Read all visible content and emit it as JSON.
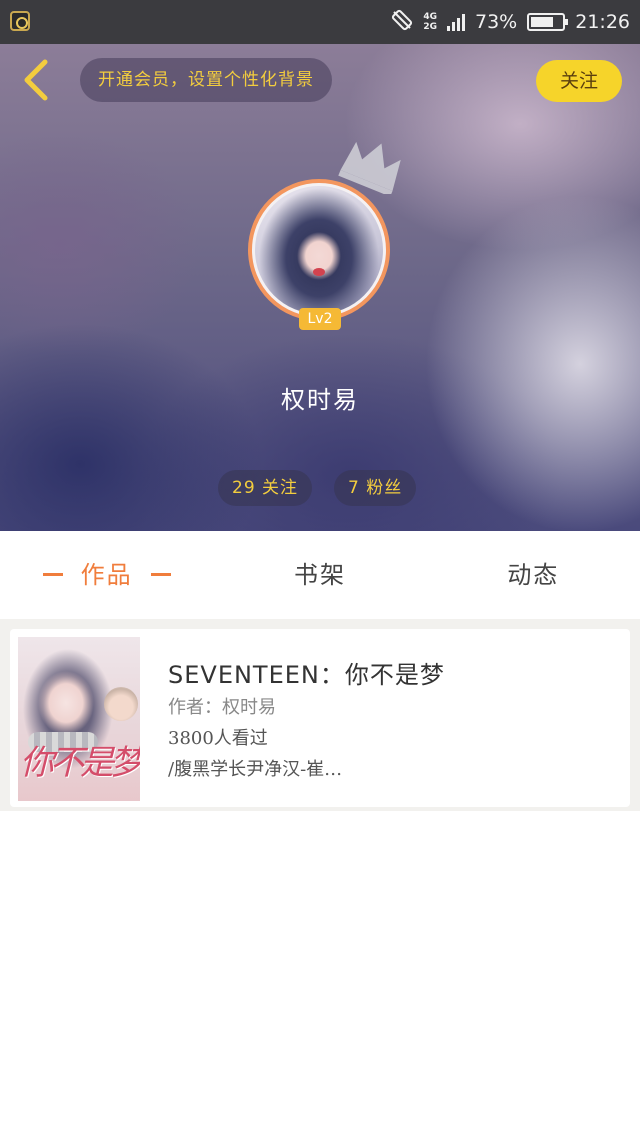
{
  "status_bar": {
    "network_top": "4G",
    "network_bottom": "2G",
    "battery_percent": "73%",
    "battery_level": 0.73,
    "time": "21:26"
  },
  "header": {
    "vip_banner": "开通会员，设置个性化背景",
    "follow_button": "关注",
    "level": "Lv2",
    "username": "权时易",
    "stats": {
      "following": "29 关注",
      "fans": "7 粉丝"
    }
  },
  "tabs": [
    {
      "label": "作品",
      "active": true
    },
    {
      "label": "书架",
      "active": false
    },
    {
      "label": "动态",
      "active": false
    }
  ],
  "books": [
    {
      "title": "SEVENTEEN：你不是梦",
      "author": "作者：权时易",
      "views": "3800人看过",
      "description": "/腹黑学长尹净汉-崔…",
      "cover_title": "你不是梦"
    }
  ],
  "colors": {
    "accent": "#f07d3c",
    "gold": "#f3cd3e",
    "follow_button_bg": "#f6d42a"
  }
}
